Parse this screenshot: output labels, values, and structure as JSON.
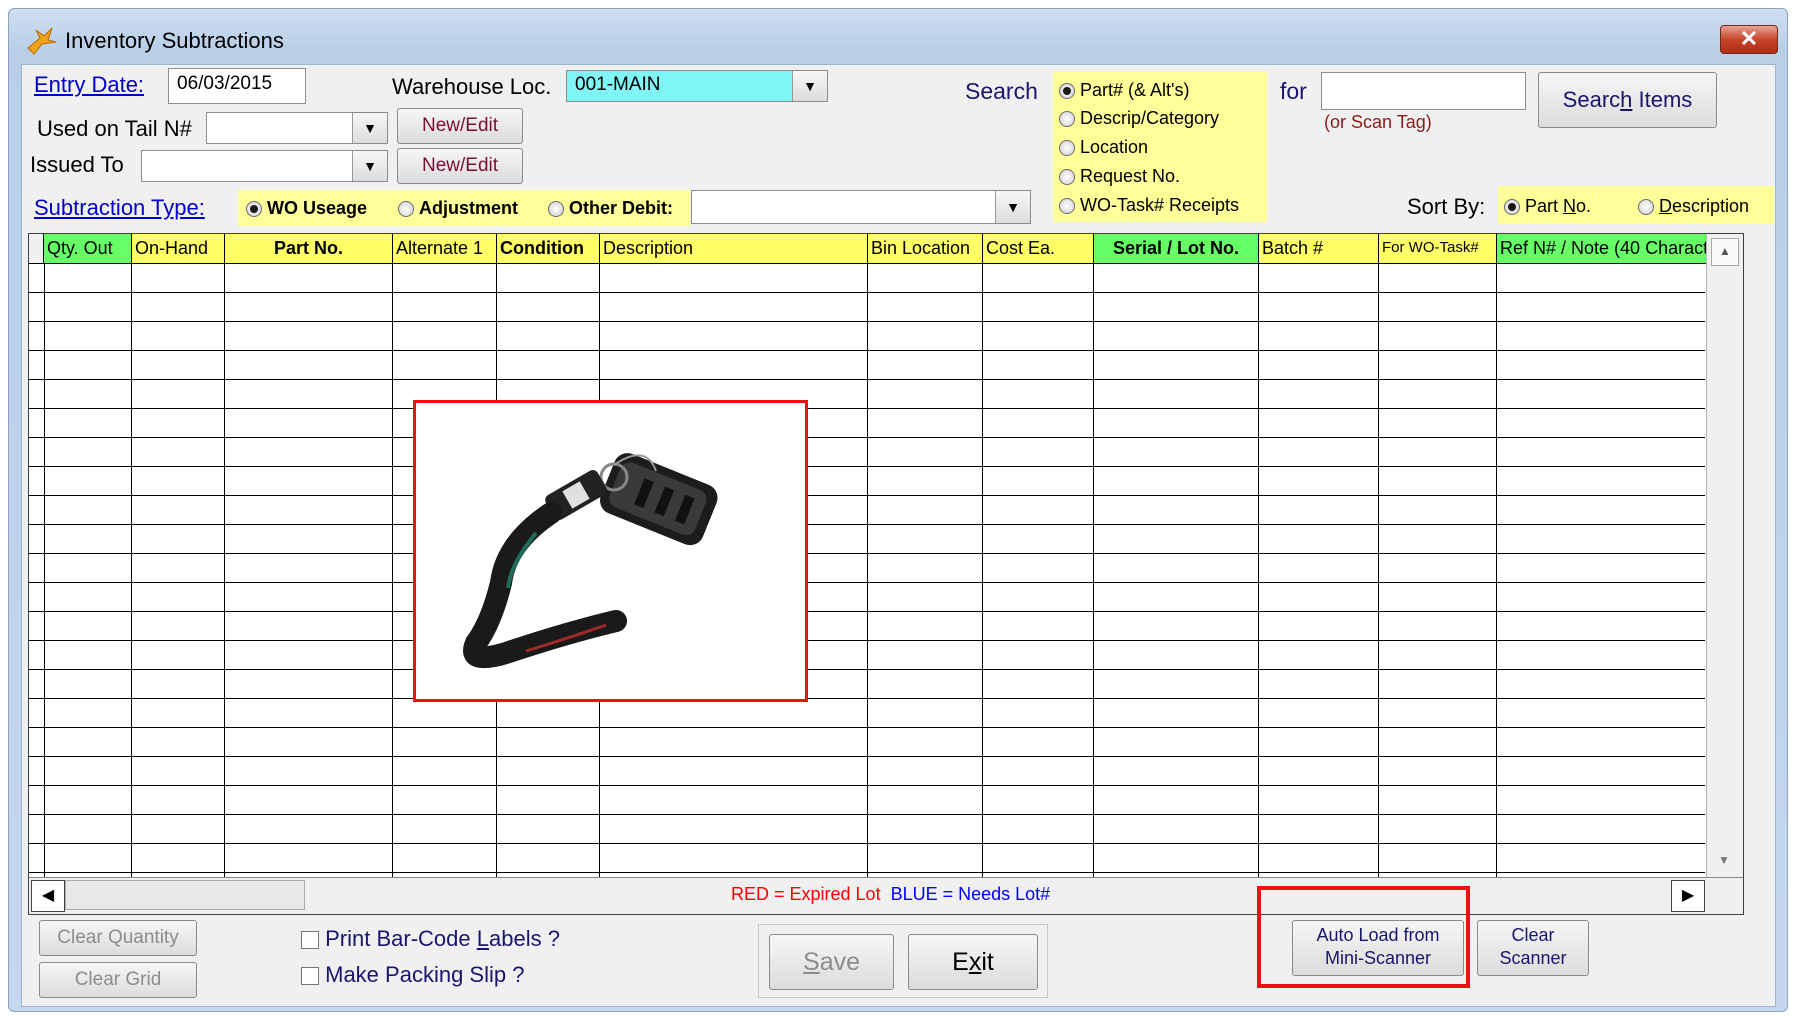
{
  "window": {
    "title": "Inventory Subtractions",
    "close_glyph": "✕",
    "app_icon": "app-bird-icon"
  },
  "header": {
    "entry_date_label": "Entry Date:",
    "entry_date_value": "06/03/2015",
    "warehouse_label": "Warehouse Loc.",
    "warehouse_value": "001-MAIN",
    "used_on_tail_label": "Used on Tail N#",
    "used_on_tail_value": "",
    "issued_to_label": "Issued To",
    "issued_to_value": "",
    "new_edit_label": "New/Edit",
    "subtraction_type_label": "Subtraction Type:",
    "subtraction_types": [
      {
        "label": "WO Useage",
        "selected": true
      },
      {
        "label": "Adjustment",
        "selected": false
      },
      {
        "label": "Other Debit:",
        "selected": false
      }
    ],
    "other_debit_value": ""
  },
  "search": {
    "label": "Search",
    "options": [
      {
        "label": "Part# (& Alt's)",
        "selected": true
      },
      {
        "label": "Descrip/Category",
        "selected": false
      },
      {
        "label": "Location",
        "selected": false
      },
      {
        "label": "Request No.",
        "selected": false
      },
      {
        "label": "WO-Task# Receipts",
        "selected": false
      }
    ],
    "for_label": "for",
    "for_value": "",
    "scan_hint": "(or Scan Tag)",
    "button_pre": "Searc",
    "button_ul": "h",
    "button_post": " Items"
  },
  "sort": {
    "label": "Sort By:",
    "opt1_pre": "Part ",
    "opt1_ul": "N",
    "opt1_post": "o.",
    "opt1_selected": true,
    "opt2_ul": "D",
    "opt2_post": "escription",
    "opt2_selected": false
  },
  "grid": {
    "columns": [
      "Qty. Out",
      "On-Hand",
      "Part No.",
      "Alternate 1",
      "Condition",
      "Description",
      "Bin Location",
      "Cost Ea.",
      "Serial / Lot No.",
      "Batch #",
      "For WO-Task#",
      "Ref N# / Note  (40 Characte"
    ],
    "legend_red": "RED = Expired Lot",
    "legend_blue": "BLUE = Needs Lot#",
    "colors": {
      "legend_red": "#ff0000",
      "legend_blue": "#0000ff",
      "header_yellow": "#ffff66",
      "header_green": "#66ff66"
    }
  },
  "overlay_image": {
    "description_icon": "mini-scanner-lanyard-image"
  },
  "footer": {
    "clear_quantity": "Clear Quantity",
    "clear_grid": "Clear Grid",
    "print_labels_pre": "Print Bar-Code ",
    "print_labels_ul": "L",
    "print_labels_post": "abels ?",
    "packing_slip": "Make Packing Slip ?",
    "save_ul": "S",
    "save_post": "ave",
    "exit_pre": "E",
    "exit_ul": "x",
    "exit_post": "it",
    "auto_load_line1": "Auto Load from",
    "auto_load_line2": "Mini-Scanner",
    "clear_scanner_line1": "Clear",
    "clear_scanner_line2": "Scanner"
  }
}
